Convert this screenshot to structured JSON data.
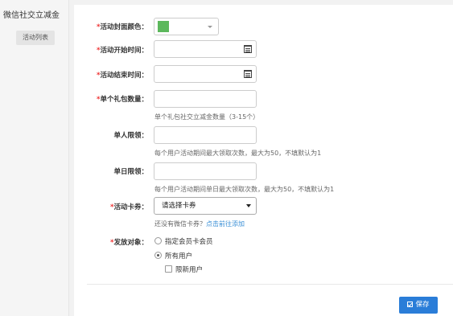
{
  "app": {
    "title": "微信社交立减金"
  },
  "sidebar": {
    "items": [
      {
        "label": "活动列表"
      }
    ]
  },
  "form": {
    "required_mark": "*",
    "cover_color": {
      "label": "活动封面颜色：",
      "value": "#5cb85c"
    },
    "start_time": {
      "label": "活动开始时间：",
      "value": ""
    },
    "end_time": {
      "label": "活动结束时间：",
      "value": ""
    },
    "gift_count": {
      "label": "单个礼包数量：",
      "value": "",
      "hint": "单个礼包社交立减金数量（3-15个）"
    },
    "per_user_limit": {
      "label": "单人限领：",
      "value": "",
      "hint": "每个用户活动期间最大领取次数，最大为50，不填默认为1"
    },
    "per_day_limit": {
      "label": "单日限领：",
      "value": "",
      "hint": "每个用户活动期间单日最大领取次数，最大为50，不填默认为1"
    },
    "card": {
      "label": "活动卡券：",
      "selected": "请选择卡券",
      "hint": "还没有微信卡券？",
      "link": "点击前往添加"
    },
    "audience": {
      "label": "发放对象：",
      "options": [
        {
          "label": "指定会员卡会员",
          "checked": false
        },
        {
          "label": "所有用户",
          "checked": true
        }
      ],
      "new_users_only": {
        "label": "限新用户",
        "checked": false
      }
    }
  },
  "footer": {
    "save_label": "保存"
  }
}
